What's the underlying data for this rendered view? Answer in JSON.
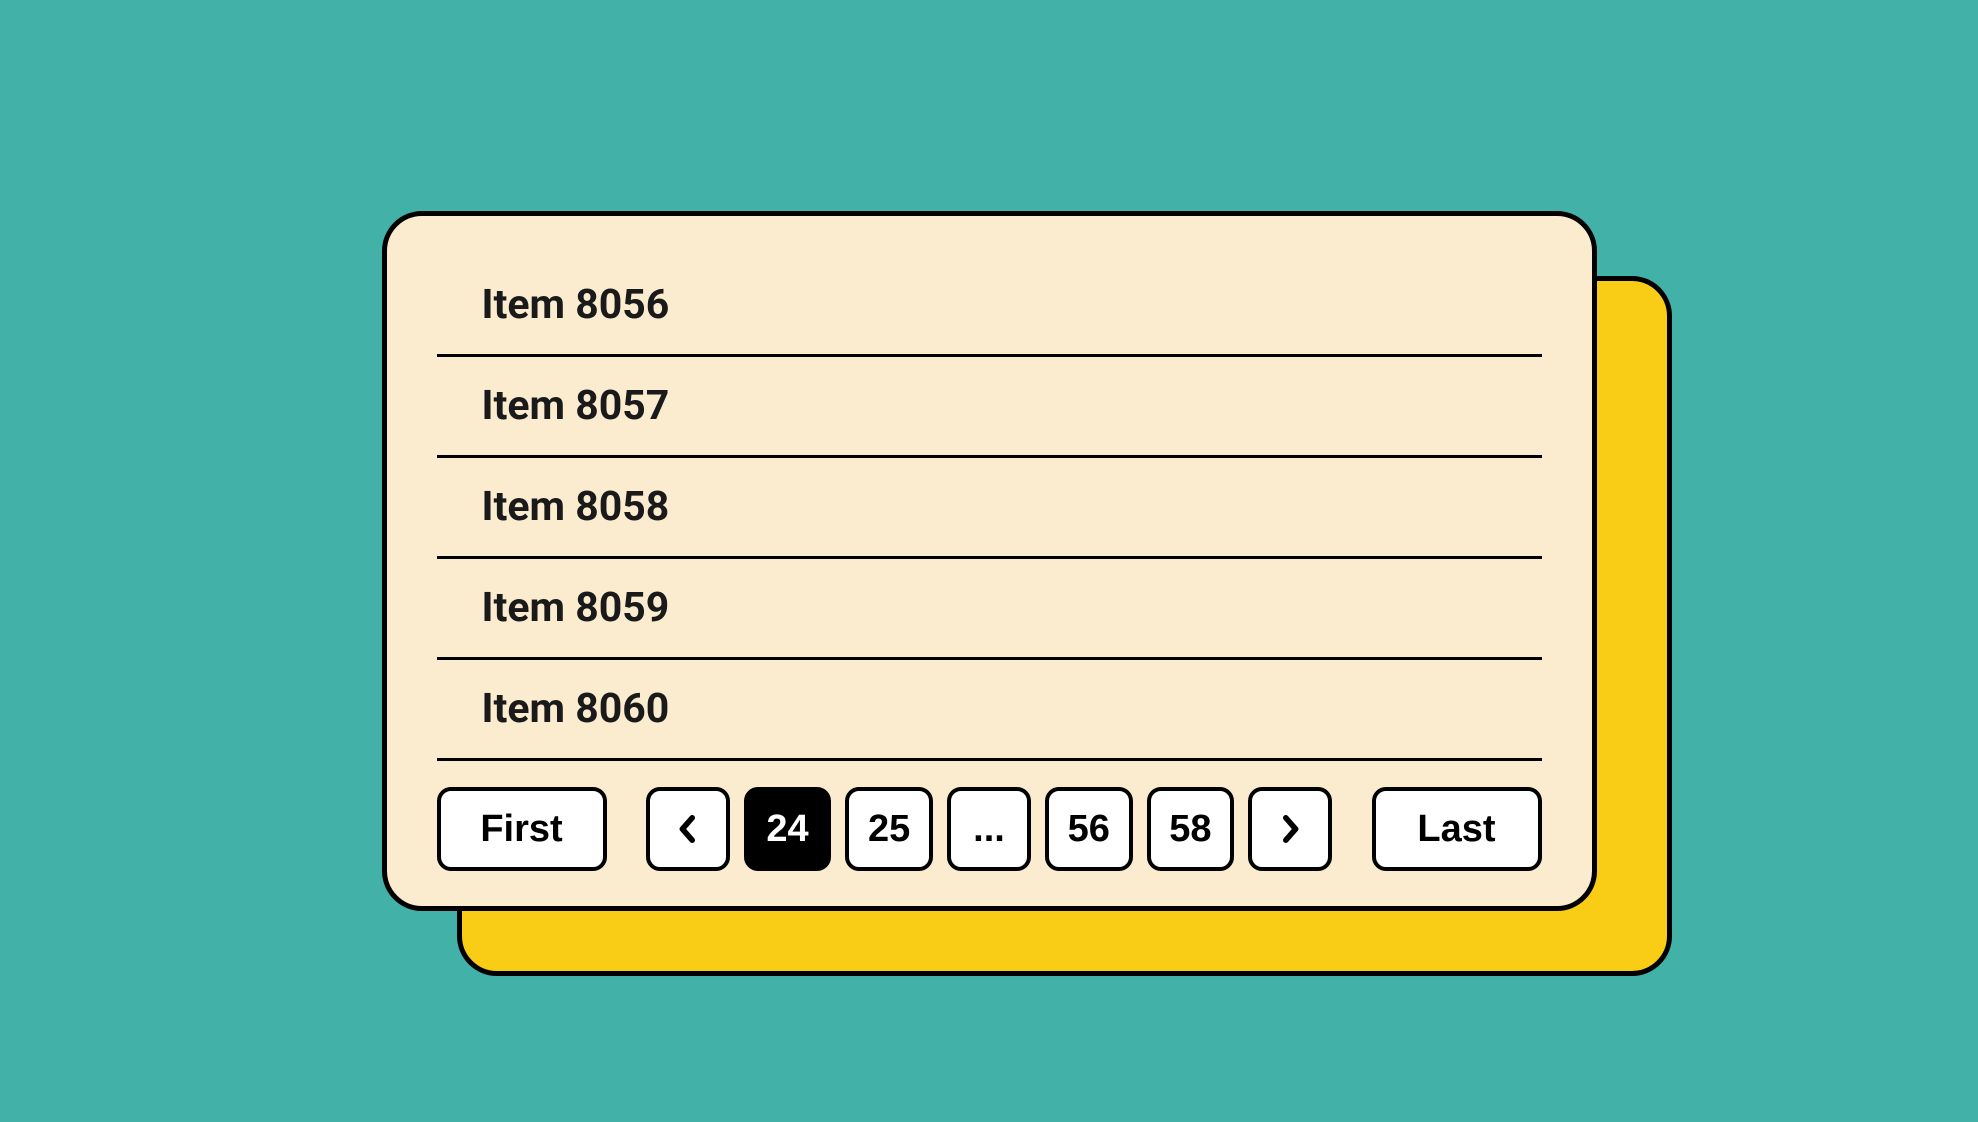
{
  "list": {
    "items": [
      "Item 8056",
      "Item 8057",
      "Item 8058",
      "Item 8059",
      "Item 8060"
    ]
  },
  "pagination": {
    "first_label": "First",
    "last_label": "Last",
    "pages": [
      "24",
      "25",
      "...",
      "56",
      "58"
    ],
    "active_index": 0
  },
  "colors": {
    "background": "#42b1a8",
    "card": "#fbecd0",
    "shadow": "#f9cd15",
    "button_bg": "#ffffff",
    "active_bg": "#000000"
  }
}
